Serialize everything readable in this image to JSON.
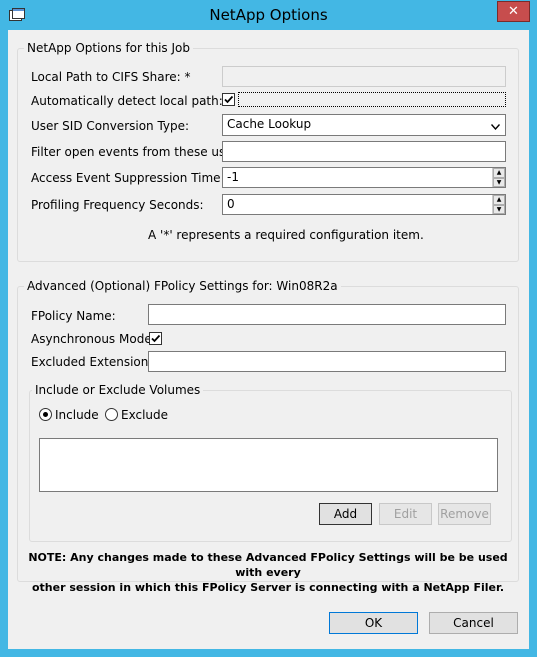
{
  "window": {
    "title": "NetApp Options",
    "close_glyph": "✕"
  },
  "job_group": {
    "title": "NetApp Options for this Job",
    "local_path_label": "Local Path to CIFS Share: *",
    "local_path_value": "",
    "auto_detect_label": "Automatically detect local path:",
    "auto_detect_checked": true,
    "sid_label": "User SID Conversion Type:",
    "sid_value": "Cache Lookup",
    "filter_label": "Filter open events from these users:",
    "filter_value": "",
    "suppression_label": "Access Event Suppression Time:",
    "suppression_value": "-1",
    "profiling_label": "Profiling Frequency Seconds:",
    "profiling_value": "0",
    "required_note": "A '*' represents a required configuration item."
  },
  "advanced_group": {
    "title": "Advanced (Optional) FPolicy Settings for: Win08R2a",
    "fpolicy_name_label": "FPolicy Name:",
    "fpolicy_name_value": "",
    "async_label": "Asynchronous Mode:",
    "async_checked": true,
    "excluded_label": "Excluded Extensions:",
    "excluded_value": "",
    "volumes_group": {
      "title": "Include or Exclude Volumes",
      "include_label": "Include",
      "exclude_label": "Exclude",
      "selected": "Include",
      "add_label": "Add",
      "edit_label": "Edit",
      "remove_label": "Remove"
    },
    "note_line1": "NOTE: Any changes made to these Advanced FPolicy Settings will be be used with every",
    "note_line2": "other session in which this FPolicy Server is connecting with a NetApp Filer."
  },
  "footer": {
    "ok_label": "OK",
    "cancel_label": "Cancel"
  },
  "colors": {
    "window_frame": "#43b7e4",
    "client_bg": "#f0f0f0",
    "close_button": "#c74d4d"
  }
}
